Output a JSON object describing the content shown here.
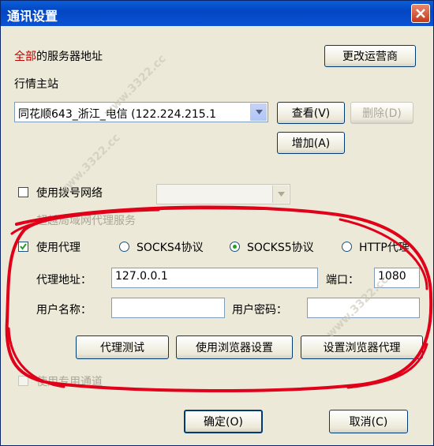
{
  "window": {
    "title": "通讯设置"
  },
  "server": {
    "label_prefix": "全部",
    "label_suffix": "的服务器地址",
    "change_operator_button": "更改运营商",
    "main_station_label": "行情主站",
    "selected_station": "同花顺643_浙江_电信 (122.224.215.1",
    "view_button": "查看(V)",
    "delete_button": "删除(D)",
    "add_button": "增加(A)"
  },
  "dialup": {
    "label": "使用拨号网络",
    "checked": false,
    "hidden_label": "超越局域网代理服务"
  },
  "proxy": {
    "use_proxy_label": "使用代理",
    "use_proxy_checked": true,
    "protocols": [
      {
        "label": "SOCKS4协议",
        "selected": false
      },
      {
        "label": "SOCKS5协议",
        "selected": true
      },
      {
        "label": "HTTP代理",
        "selected": false
      }
    ],
    "address_label": "代理地址：",
    "address_value": "127.0.0.1",
    "port_label": "端口：",
    "port_value": "1080",
    "username_label": "用户名称：",
    "username_value": "",
    "password_label": "用户密码：",
    "password_value": "",
    "test_button": "代理测试",
    "use_browser_button": "使用浏览器设置",
    "set_browser_button": "设置浏览器代理"
  },
  "special_channel": {
    "label": "使用专用通道",
    "checked": false
  },
  "footer": {
    "ok_button": "确定(O)",
    "cancel_button": "取消(C)"
  },
  "watermark": "www.3322.cc",
  "colors": {
    "titlebar": "#0346c3",
    "accent_red": "#c00000",
    "scribble": "#e0001a"
  }
}
